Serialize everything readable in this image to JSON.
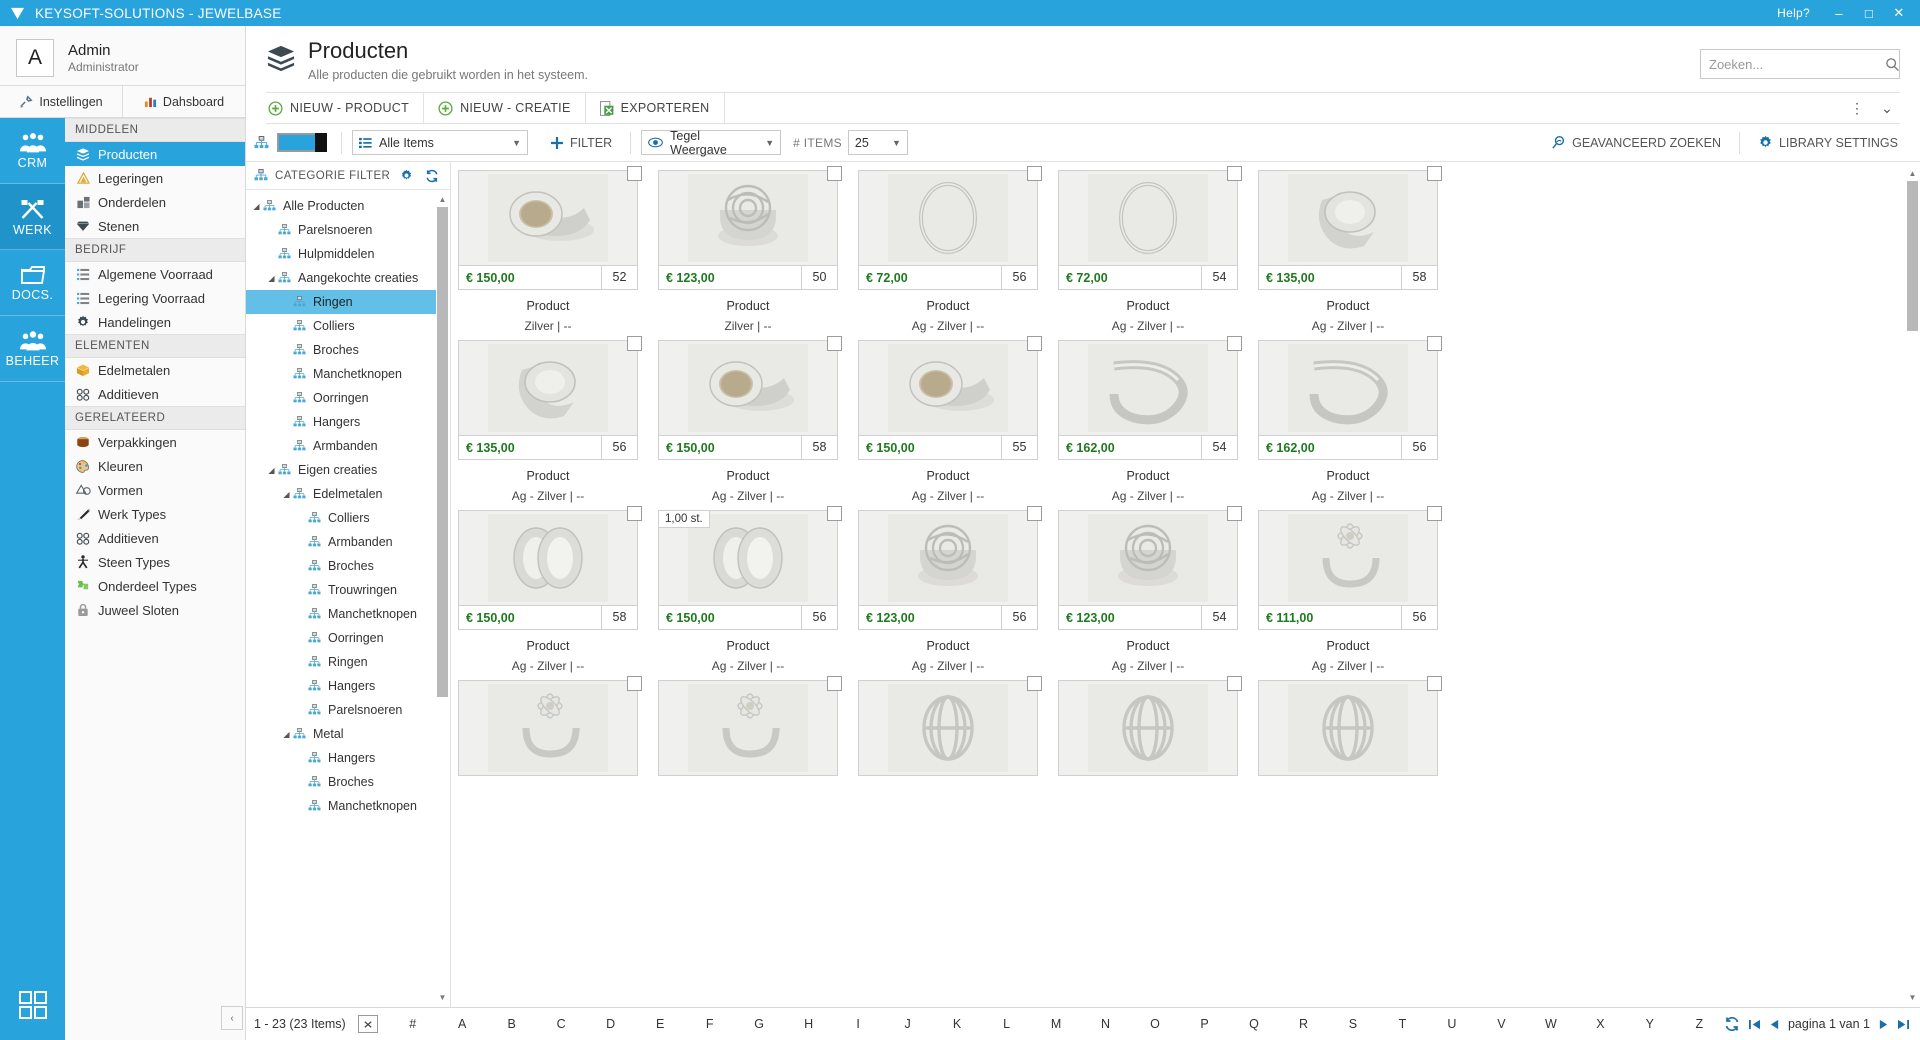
{
  "titlebar": {
    "app_title": "KEYSOFT-SOLUTIONS - JEWELBASE",
    "help_label": "Help?",
    "minimize": "–",
    "maximize": "□",
    "close": "✕",
    "accent_color": "#29a3dc"
  },
  "user": {
    "avatar_letter": "A",
    "name": "Admin",
    "role": "Administrator",
    "tabs": [
      {
        "label": "Instellingen",
        "icon": "tools-icon"
      },
      {
        "label": "Dahsboard",
        "icon": "chart-icon"
      }
    ]
  },
  "rail": [
    {
      "label": "CRM",
      "icon": "people-icon",
      "active": false
    },
    {
      "label": "WERK",
      "icon": "hammer-icon",
      "active": true
    },
    {
      "label": "DOCS.",
      "icon": "folder-icon",
      "active": false
    },
    {
      "label": "BEHEER",
      "icon": "admin-people-icon",
      "active": false
    }
  ],
  "rail_bottom_icon": "grid-squares-icon",
  "sidebar": {
    "groups": [
      {
        "title": "MIDDELEN",
        "items": [
          {
            "label": "Producten",
            "icon": "box-icon",
            "active": true
          },
          {
            "label": "Legeringen",
            "icon": "alloy-icon",
            "active": false
          },
          {
            "label": "Onderdelen",
            "icon": "parts-icon",
            "active": false
          },
          {
            "label": "Stenen",
            "icon": "gem-icon",
            "active": false
          }
        ]
      },
      {
        "title": "BEDRIJF",
        "items": [
          {
            "label": "Algemene Voorraad",
            "icon": "list-icon",
            "active": false
          },
          {
            "label": "Legering Voorraad",
            "icon": "list-icon",
            "active": false
          },
          {
            "label": "Handelingen",
            "icon": "gear-icon",
            "active": false
          }
        ]
      },
      {
        "title": "ELEMENTEN",
        "items": [
          {
            "label": "Edelmetalen",
            "icon": "gold-box-icon",
            "active": false
          },
          {
            "label": "Additieven",
            "icon": "additive-icon",
            "active": false
          }
        ]
      },
      {
        "title": "GERELATEERD",
        "items": [
          {
            "label": "Verpakkingen",
            "icon": "package-icon",
            "active": false
          },
          {
            "label": "Kleuren",
            "icon": "palette-icon",
            "active": false
          },
          {
            "label": "Vormen",
            "icon": "shapes-icon",
            "active": false
          },
          {
            "label": "Werk Types",
            "icon": "pen-icon",
            "active": false
          },
          {
            "label": "Additieven",
            "icon": "additive-icon",
            "active": false
          },
          {
            "label": "Steen Types",
            "icon": "stone-type-icon",
            "active": false
          },
          {
            "label": "Onderdeel Types",
            "icon": "puzzle-icon",
            "active": false
          },
          {
            "label": "Juweel Sloten",
            "icon": "lock-icon",
            "active": false
          }
        ]
      }
    ]
  },
  "page": {
    "title": "Producten",
    "subtitle": "Alle producten die gebruikt worden in het systeem.",
    "icon": "box-stack-icon"
  },
  "search": {
    "placeholder": "Zoeken...",
    "value": "",
    "icon": "search-icon"
  },
  "commands": [
    {
      "label": "NIEUW - PRODUCT",
      "icon": "plus-circle-icon"
    },
    {
      "label": "NIEUW - CREATIE",
      "icon": "plus-circle-icon"
    },
    {
      "label": "EXPORTEREN",
      "icon": "excel-export-icon"
    }
  ],
  "command_overflow": {
    "more": "⋮",
    "collapse": "⌄"
  },
  "filterbar": {
    "tree_icon": "sitemap-icon",
    "toggle_on": true,
    "items_select": {
      "label": "Alle Items",
      "icon": "list-icon"
    },
    "filter_button": {
      "label": "FILTER",
      "icon": "plus-icon"
    },
    "view_select": {
      "label": "Tegel Weergave",
      "icon": "eye-icon"
    },
    "items_count_label": "# ITEMS",
    "items_count_value": "25",
    "advanced_search": {
      "label": "GEAVANCEERD ZOEKEN",
      "icon": "magnifier-pin-icon"
    },
    "library_settings": {
      "label": "LIBRARY SETTINGS",
      "icon": "gear-icon"
    }
  },
  "category_filter": {
    "title": "CATEGORIE FILTER",
    "icon": "sitemap-icon",
    "settings_icon": "gear-icon",
    "refresh_icon": "refresh-icon",
    "nodes": [
      {
        "label": "Alle Producten",
        "depth": 0,
        "expander": "◢",
        "selected": false
      },
      {
        "label": "Parelsnoeren",
        "depth": 1,
        "expander": "",
        "selected": false
      },
      {
        "label": "Hulpmiddelen",
        "depth": 1,
        "expander": "",
        "selected": false
      },
      {
        "label": "Aangekochte creaties",
        "depth": 1,
        "expander": "◢",
        "selected": false
      },
      {
        "label": "Ringen",
        "depth": 2,
        "expander": "",
        "selected": true
      },
      {
        "label": "Colliers",
        "depth": 2,
        "expander": "",
        "selected": false
      },
      {
        "label": "Broches",
        "depth": 2,
        "expander": "",
        "selected": false
      },
      {
        "label": "Manchetknopen",
        "depth": 2,
        "expander": "",
        "selected": false
      },
      {
        "label": "Oorringen",
        "depth": 2,
        "expander": "",
        "selected": false
      },
      {
        "label": "Hangers",
        "depth": 2,
        "expander": "",
        "selected": false
      },
      {
        "label": "Armbanden",
        "depth": 2,
        "expander": "",
        "selected": false
      },
      {
        "label": "Eigen creaties",
        "depth": 1,
        "expander": "◢",
        "selected": false
      },
      {
        "label": "Edelmetalen",
        "depth": 2,
        "expander": "◢",
        "selected": false
      },
      {
        "label": "Colliers",
        "depth": 3,
        "expander": "",
        "selected": false
      },
      {
        "label": "Armbanden",
        "depth": 3,
        "expander": "",
        "selected": false
      },
      {
        "label": "Broches",
        "depth": 3,
        "expander": "",
        "selected": false
      },
      {
        "label": "Trouwringen",
        "depth": 3,
        "expander": "",
        "selected": false
      },
      {
        "label": "Manchetknopen",
        "depth": 3,
        "expander": "",
        "selected": false
      },
      {
        "label": "Oorringen",
        "depth": 3,
        "expander": "",
        "selected": false
      },
      {
        "label": "Ringen",
        "depth": 3,
        "expander": "",
        "selected": false
      },
      {
        "label": "Hangers",
        "depth": 3,
        "expander": "",
        "selected": false
      },
      {
        "label": "Parelsnoeren",
        "depth": 3,
        "expander": "",
        "selected": false
      },
      {
        "label": "Metal",
        "depth": 2,
        "expander": "◢",
        "selected": false
      },
      {
        "label": "Hangers",
        "depth": 3,
        "expander": "",
        "selected": false
      },
      {
        "label": "Broches",
        "depth": 3,
        "expander": "",
        "selected": false
      },
      {
        "label": "Manchetknopen",
        "depth": 3,
        "expander": "",
        "selected": false
      }
    ]
  },
  "tiles": [
    {
      "price": "€ 150,00",
      "num": "52",
      "caption": "Product",
      "sub": "Zilver | --",
      "qty": "",
      "img": "ring-oval-pave",
      "checked": false
    },
    {
      "price": "€ 123,00",
      "num": "50",
      "caption": "Product",
      "sub": "Zilver | --",
      "qty": "",
      "img": "ring-rose",
      "checked": false
    },
    {
      "price": "€ 72,00",
      "num": "56",
      "caption": "Product",
      "sub": "Ag - Zilver | --",
      "qty": "",
      "img": "ring-thin",
      "checked": false
    },
    {
      "price": "€ 72,00",
      "num": "54",
      "caption": "Product",
      "sub": "Ag - Zilver | --",
      "qty": "",
      "img": "ring-thin",
      "checked": false
    },
    {
      "price": "€ 135,00",
      "num": "58",
      "caption": "Product",
      "sub": "Ag - Zilver | --",
      "qty": "",
      "img": "ring-band-wide",
      "checked": false
    },
    {
      "price": "€ 135,00",
      "num": "56",
      "caption": "Product",
      "sub": "Ag - Zilver | --",
      "qty": "",
      "img": "ring-band-wide",
      "checked": false
    },
    {
      "price": "€ 150,00",
      "num": "58",
      "caption": "Product",
      "sub": "Ag - Zilver | --",
      "qty": "",
      "img": "ring-oval-pave",
      "checked": false
    },
    {
      "price": "€ 150,00",
      "num": "55",
      "caption": "Product",
      "sub": "Ag - Zilver | --",
      "qty": "",
      "img": "ring-oval-pave",
      "checked": false
    },
    {
      "price": "€ 162,00",
      "num": "54",
      "caption": "Product",
      "sub": "Ag - Zilver | --",
      "qty": "",
      "img": "ring-swoosh",
      "checked": false
    },
    {
      "price": "€ 162,00",
      "num": "56",
      "caption": "Product",
      "sub": "Ag - Zilver | --",
      "qty": "",
      "img": "ring-swoosh",
      "checked": false
    },
    {
      "price": "€ 150,00",
      "num": "58",
      "caption": "Product",
      "sub": "Ag - Zilver | --",
      "qty": "",
      "img": "ring-double-band",
      "checked": false
    },
    {
      "price": "€ 150,00",
      "num": "56",
      "caption": "Product",
      "sub": "Ag - Zilver | --",
      "qty": "1,00 st.",
      "img": "ring-double-band",
      "checked": false
    },
    {
      "price": "€ 123,00",
      "num": "56",
      "caption": "Product",
      "sub": "Ag - Zilver | --",
      "qty": "",
      "img": "ring-rose",
      "checked": false
    },
    {
      "price": "€ 123,00",
      "num": "54",
      "caption": "Product",
      "sub": "Ag - Zilver | --",
      "qty": "",
      "img": "ring-rose",
      "checked": false
    },
    {
      "price": "€ 111,00",
      "num": "56",
      "caption": "Product",
      "sub": "Ag - Zilver | --",
      "qty": "",
      "img": "ring-flower",
      "checked": false
    },
    {
      "price": "",
      "num": "",
      "caption": "",
      "sub": "",
      "qty": "",
      "img": "ring-flower",
      "checked": false
    },
    {
      "price": "",
      "num": "",
      "caption": "",
      "sub": "",
      "qty": "",
      "img": "ring-flower",
      "checked": false
    },
    {
      "price": "",
      "num": "",
      "caption": "",
      "sub": "",
      "qty": "",
      "img": "ring-cage",
      "checked": false
    },
    {
      "price": "",
      "num": "",
      "caption": "",
      "sub": "",
      "qty": "",
      "img": "ring-cage",
      "checked": false
    },
    {
      "price": "",
      "num": "",
      "caption": "",
      "sub": "",
      "qty": "",
      "img": "ring-cage",
      "checked": false
    }
  ],
  "bottombar": {
    "count_text": "1 - 23 (23 Items)",
    "clear_icon": "clear-filter-icon",
    "letters": [
      "#",
      "A",
      "B",
      "C",
      "D",
      "E",
      "F",
      "G",
      "H",
      "I",
      "J",
      "K",
      "L",
      "M",
      "N",
      "O",
      "P",
      "Q",
      "R",
      "S",
      "T",
      "U",
      "V",
      "W",
      "X",
      "Y",
      "Z"
    ],
    "refresh_icon": "refresh-icon",
    "first_icon": "⏮",
    "prev_icon": "◀",
    "page_text": "pagina 1 van 1",
    "next_icon": "▶",
    "last_icon": "⏭"
  },
  "collapse_handle": "‹"
}
